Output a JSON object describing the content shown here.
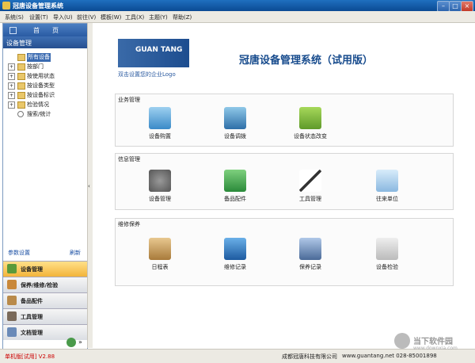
{
  "window": {
    "title": "冠唐设备管理系统"
  },
  "menu": [
    "系统(S)",
    "设置(T)",
    "导入(U)",
    "前往(V)",
    "模板(W)",
    "工具(X)",
    "主题(Y)",
    "帮助(Z)"
  ],
  "left": {
    "home": "首　　页",
    "section": "设备管理",
    "tree": [
      "所有设备",
      "按部门",
      "按使用状态",
      "按设备类型",
      "按设备标识",
      "检验情况",
      "搜索/统计"
    ],
    "links": {
      "params": "参数设置",
      "refresh": "刷新"
    },
    "nav": [
      "设备管理",
      "保养/维修/检验",
      "备品配件",
      "工具管理",
      "文档管理"
    ]
  },
  "main": {
    "logo": {
      "brand": "GUAN TANG",
      "tagline": "双击设置您的企业Logo"
    },
    "title": "冠唐设备管理系统（试用版）",
    "groups": [
      {
        "label": "业务管理",
        "items": [
          "设备购置",
          "设备调拨",
          "设备状态改变"
        ]
      },
      {
        "label": "信息管理",
        "items": [
          "设备管理",
          "备品配件",
          "工具管理",
          "往来单位"
        ]
      },
      {
        "label": "维修保养",
        "items": [
          "日程表",
          "维修记录",
          "保养记录",
          "设备检验"
        ]
      }
    ]
  },
  "status": {
    "version": "单机版[试用]  V2.88",
    "company": "成都冠唐科技有限公司",
    "site": "www.guantang.net   028-85001898"
  },
  "watermark": {
    "text": "当下软件园",
    "url": "www.downxia.com"
  }
}
